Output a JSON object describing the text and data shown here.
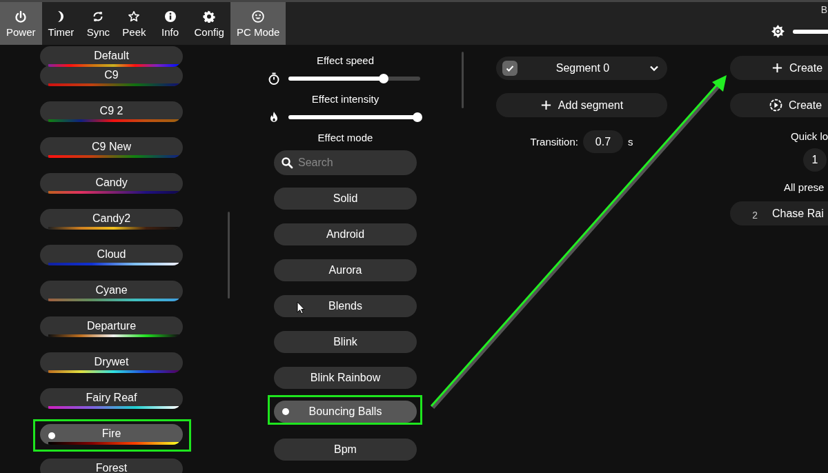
{
  "nav": {
    "buttons": [
      {
        "label": "Power",
        "kind": "power",
        "selected": true
      },
      {
        "label": "Timer",
        "kind": "moon",
        "selected": false
      },
      {
        "label": "Sync",
        "kind": "sync",
        "selected": false
      },
      {
        "label": "Peek",
        "kind": "star",
        "selected": false
      },
      {
        "label": "Info",
        "kind": "info",
        "selected": false
      },
      {
        "label": "Config",
        "kind": "gear",
        "selected": false
      },
      {
        "label": "PC Mode",
        "kind": "smiley",
        "selected": true
      }
    ],
    "brightness": {
      "label": "B",
      "level": 1
    }
  },
  "palettes": [
    {
      "name": "Default",
      "selected": false,
      "highlighted": false
    },
    {
      "name": "C9",
      "selected": false,
      "highlighted": false
    },
    {
      "name": "C9 2",
      "selected": false,
      "highlighted": false
    },
    {
      "name": "C9 New",
      "selected": false,
      "highlighted": false
    },
    {
      "name": "Candy",
      "selected": false,
      "highlighted": false
    },
    {
      "name": "Candy2",
      "selected": false,
      "highlighted": false
    },
    {
      "name": "Cloud",
      "selected": false,
      "highlighted": false
    },
    {
      "name": "Cyane",
      "selected": false,
      "highlighted": false
    },
    {
      "name": "Departure",
      "selected": false,
      "highlighted": false
    },
    {
      "name": "Drywet",
      "selected": false,
      "highlighted": false
    },
    {
      "name": "Fairy Reaf",
      "selected": false,
      "highlighted": false
    },
    {
      "name": "Fire",
      "selected": true,
      "highlighted": true
    },
    {
      "name": "Forest",
      "selected": false,
      "highlighted": false
    }
  ],
  "effects": {
    "speed": {
      "label": "Effect speed",
      "kind": "timer",
      "level": 0.71
    },
    "intensity": {
      "label": "Effect intensity",
      "kind": "flame",
      "level": 0.98
    },
    "mode_label": "Effect mode",
    "search": {
      "placeholder": "Search"
    },
    "items": [
      {
        "name": "Solid",
        "selected": false,
        "highlighted": false
      },
      {
        "name": "Android",
        "selected": false,
        "highlighted": false
      },
      {
        "name": "Aurora",
        "selected": false,
        "highlighted": false
      },
      {
        "name": "Blends",
        "selected": false,
        "highlighted": false
      },
      {
        "name": "Blink",
        "selected": false,
        "highlighted": false
      },
      {
        "name": "Blink Rainbow",
        "selected": false,
        "highlighted": false
      },
      {
        "name": "Bouncing Balls",
        "selected": true,
        "highlighted": true
      },
      {
        "name": "Bpm",
        "selected": false,
        "highlighted": false
      }
    ]
  },
  "segments": {
    "items": [
      {
        "name": "Segment 0",
        "checked": true,
        "expanded": false
      }
    ],
    "add_button": "Add segment",
    "transition": {
      "label": "Transition:",
      "value": "0.7",
      "unit": "s"
    }
  },
  "presets": {
    "create_preset": "Create",
    "create_playlist": "Create",
    "quick_load_label": "Quick lo",
    "quick_load": [
      "1"
    ],
    "all_label": "All prese",
    "items": [
      {
        "number": "2",
        "name": "Chase Rai"
      }
    ]
  }
}
